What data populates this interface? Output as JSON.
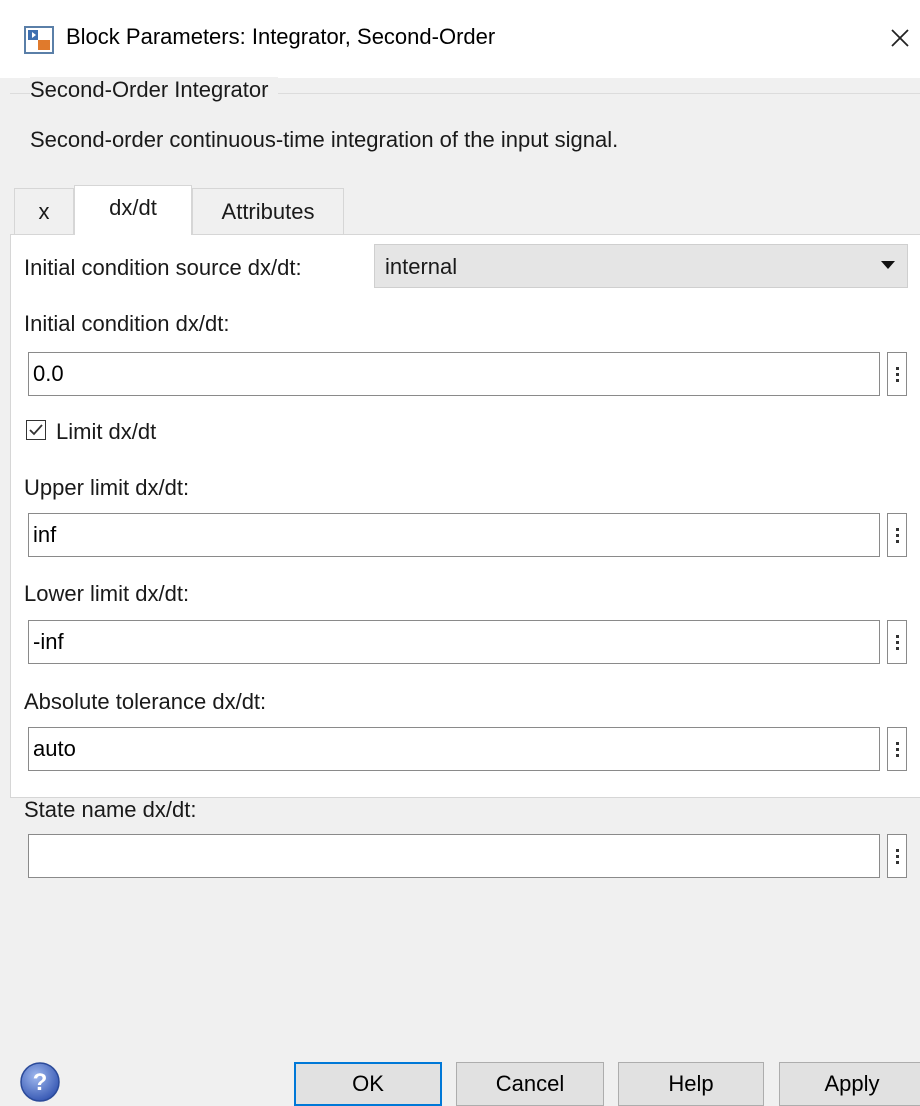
{
  "window": {
    "title": "Block Parameters: Integrator, Second-Order",
    "app_icon": "simulink-block-icon",
    "close_icon": "close-icon"
  },
  "block": {
    "group_title": "Second-Order Integrator",
    "description": "Second-order continuous-time integration of the input signal."
  },
  "tabs": [
    {
      "label": "x",
      "active": false
    },
    {
      "label": "dx/dt",
      "active": true
    },
    {
      "label": "Attributes",
      "active": false
    }
  ],
  "params": {
    "ic_source_label": "Initial condition source dx/dt:",
    "ic_source_value": "internal",
    "ic_label": "Initial condition dx/dt:",
    "ic_value": "0.0",
    "limit_label": "Limit dx/dt",
    "limit_checked": true,
    "upper_label": "Upper limit dx/dt:",
    "upper_value": "inf",
    "lower_label": "Lower limit dx/dt:",
    "lower_value": "-inf",
    "abstol_label": "Absolute tolerance dx/dt:",
    "abstol_value": "auto",
    "state_label": "State name dx/dt:",
    "state_value": ""
  },
  "buttons": {
    "ok": "OK",
    "cancel": "Cancel",
    "help": "Help",
    "apply": "Apply"
  },
  "colors": {
    "accent": "#0078d7",
    "panel_bg": "#ffffff",
    "window_bg": "#f0f0f0"
  }
}
